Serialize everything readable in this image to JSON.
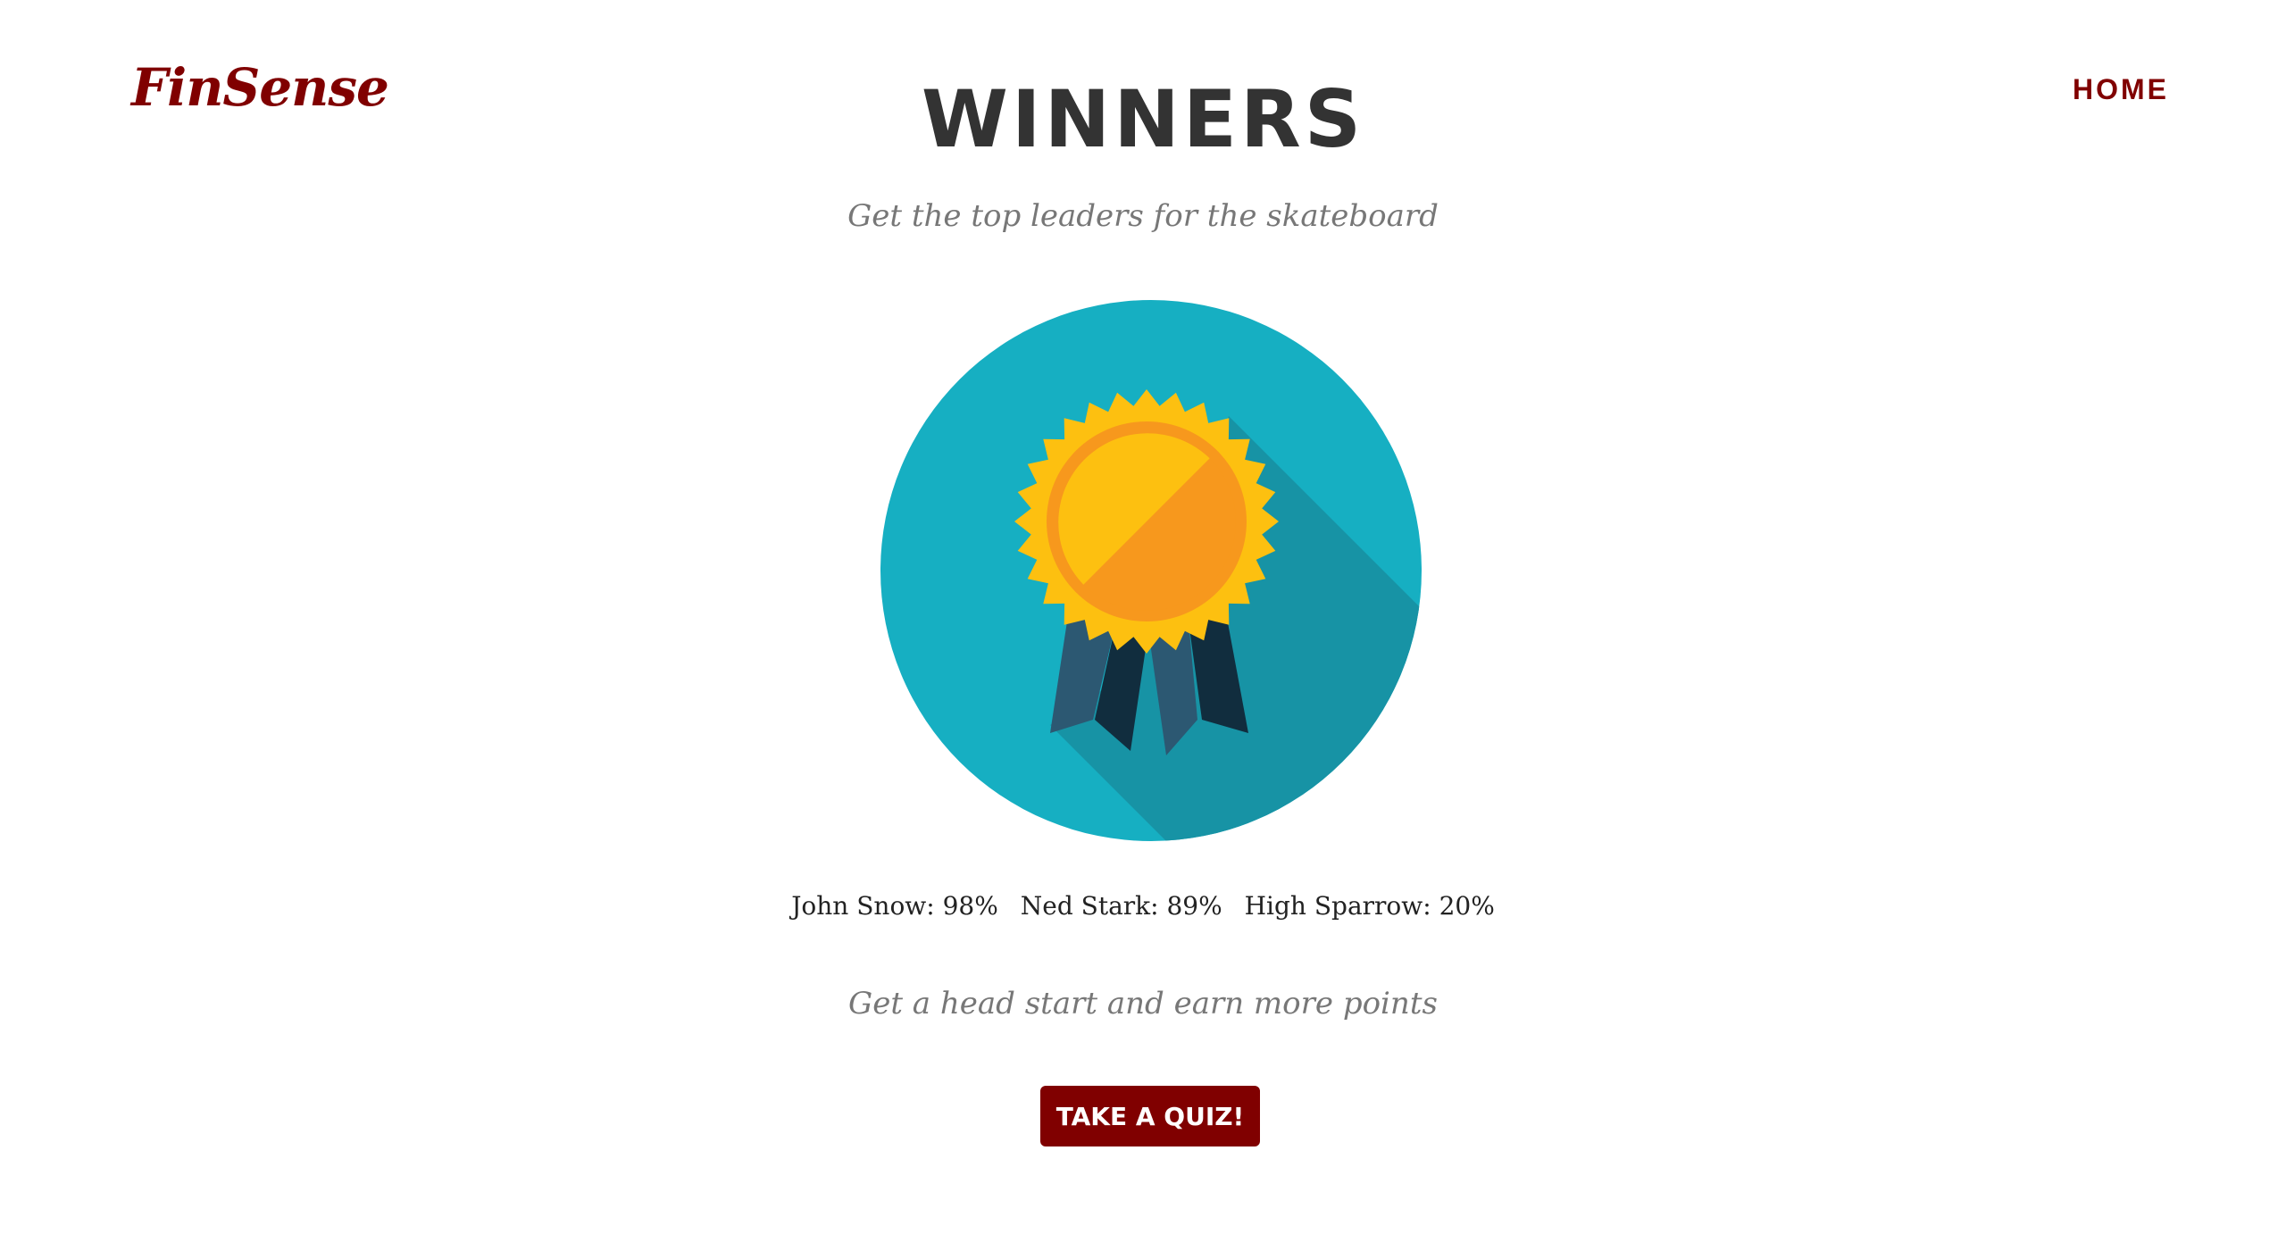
{
  "header": {
    "brand": "FinSense",
    "nav_home": "HOME"
  },
  "main": {
    "title": "WINNERS",
    "subtitle": "Get the top leaders for the skateboard",
    "leaders": [
      {
        "text": "John Snow: 98%"
      },
      {
        "text": "Ned Stark: 89%"
      },
      {
        "text": "High Sparrow: 20%"
      }
    ],
    "cta_text": "Get a head start and earn more points",
    "quiz_button": "TAKE A QUIZ!"
  },
  "icons": {
    "medal": "award-medal-icon"
  },
  "colors": {
    "brand": "#800000",
    "circle": "#16AFC2",
    "shadow": "#1793A5",
    "medal_outer": "#FDC010",
    "medal_inner": "#F7981D",
    "ribbon_light": "#2C5872",
    "ribbon_dark": "#112D3E"
  }
}
